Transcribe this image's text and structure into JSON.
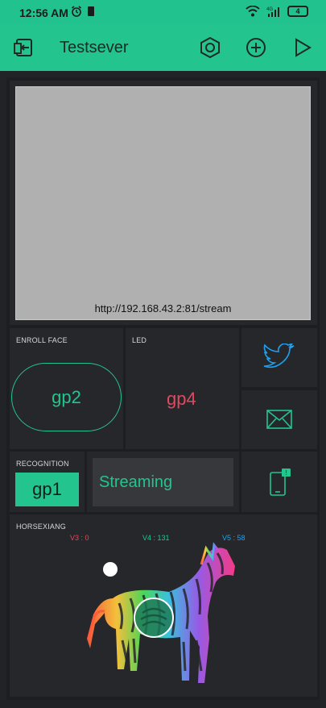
{
  "status_bar": {
    "time": "12:56 AM",
    "network": "4G",
    "battery": "4"
  },
  "app_bar": {
    "title": "Testsever"
  },
  "video": {
    "url": "http://192.168.43.2:81/stream"
  },
  "enroll_face": {
    "label": "ENROLL FACE",
    "button": "gp2"
  },
  "led": {
    "label": "LED",
    "value": "gp4"
  },
  "recognition": {
    "label": "RECOGNITION",
    "button": "gp1"
  },
  "terminal": {
    "text": "Streaming"
  },
  "joystick": {
    "label": "HORSEXIANG",
    "v3": "V3 : 0",
    "v4": "V4 : 131",
    "v5": "V5 : 58"
  },
  "colors": {
    "accent": "#23c48e",
    "led_red": "#e2495f",
    "twitter_blue": "#1da1f2",
    "v3_color": "#e2495f",
    "v4_color": "#23c48e",
    "v5_color": "#1da1f2"
  }
}
